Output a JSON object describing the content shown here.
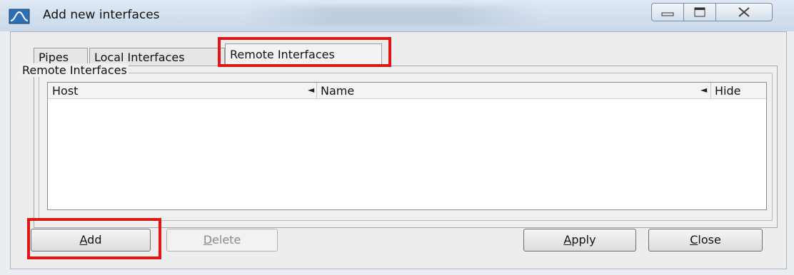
{
  "window": {
    "title": "Add new interfaces",
    "controls": [
      "minimize",
      "maximize",
      "close"
    ]
  },
  "tabs": [
    {
      "label": "Pipes",
      "active": false
    },
    {
      "label": "Local Interfaces",
      "active": false
    },
    {
      "label": "Remote Interfaces",
      "active": true
    }
  ],
  "group": {
    "label": "Remote Interfaces"
  },
  "table": {
    "columns": [
      {
        "label": "Host",
        "sort_indicator": "◄"
      },
      {
        "label": "Name",
        "sort_indicator": "◄"
      },
      {
        "label": "Hide"
      }
    ],
    "rows": []
  },
  "buttons": {
    "add": {
      "first": "A",
      "rest": "dd"
    },
    "delete": {
      "first": "D",
      "rest": "elete"
    },
    "apply": {
      "first": "A",
      "rest": "pply"
    },
    "close": {
      "first": "C",
      "rest": "lose"
    }
  },
  "highlight_color": "#e01515"
}
